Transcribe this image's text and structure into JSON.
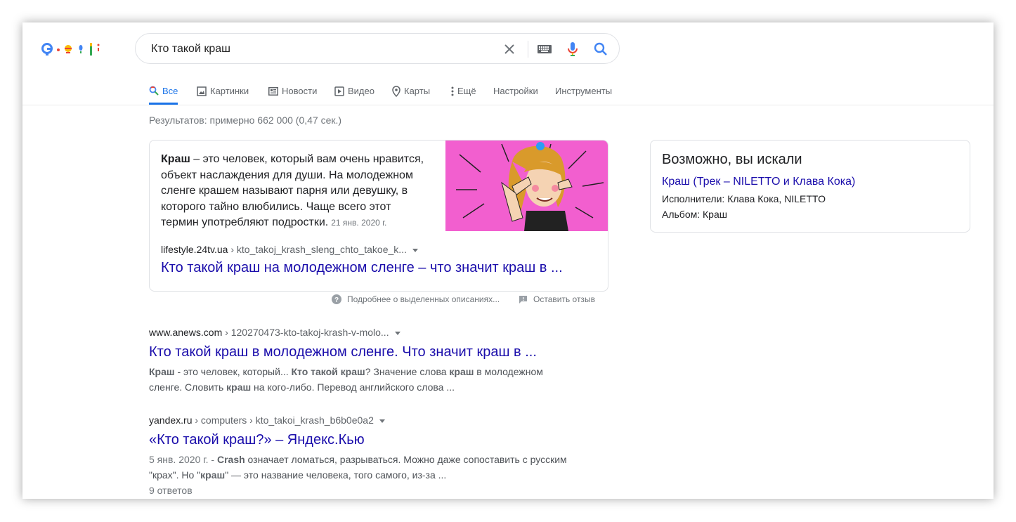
{
  "search": {
    "query": "Кто такой краш",
    "clear_icon": "close-icon",
    "keyboard_icon": "keyboard-icon",
    "mic_icon": "microphone-icon",
    "search_icon": "search-icon"
  },
  "tabs": [
    {
      "label": "Все",
      "icon": "search-icon",
      "active": true
    },
    {
      "label": "Картинки",
      "icon": "image-icon"
    },
    {
      "label": "Новости",
      "icon": "news-icon"
    },
    {
      "label": "Видео",
      "icon": "video-icon"
    },
    {
      "label": "Карты",
      "icon": "map-pin-icon"
    },
    {
      "label": "Ещё",
      "icon": "more-vert-icon"
    },
    {
      "label": "Настройки"
    },
    {
      "label": "Инструменты"
    }
  ],
  "stats": "Результатов: примерно 662 000 (0,47 сек.)",
  "featured": {
    "bold": "Краш",
    "text": " – это человек, который вам очень нравится, объект наслаждения для души. На молодежном сленге крашем называют парня или девушку, в которого тайно влюбились. Чаще всего этот термин употребляют подростки.",
    "date": "21 янв. 2020 г.",
    "domain": "lifestyle.24tv.ua",
    "path": " › kto_takoj_krash_sleng_chto_takoe_k...",
    "title": "Кто такой краш на молодежном сленге – что значит краш в ...",
    "image_alt": "cartoon girl with hands on face"
  },
  "feedback": {
    "about": "Подробнее о выделенных описаниях...",
    "send": "Оставить отзыв"
  },
  "results": [
    {
      "domain": "www.anews.com",
      "path": " › 120270473-kto-takoj-krash-v-molo...",
      "title": "Кто такой краш в молодежном сленге. Что значит краш в ...",
      "desc": [
        {
          "b": "Краш"
        },
        {
          "t": " - это человек, который... "
        },
        {
          "b": "Кто такой краш"
        },
        {
          "t": "? Значение слова "
        },
        {
          "b": "краш"
        },
        {
          "t": " в молодежном сленге. Словить "
        },
        {
          "b": "краш"
        },
        {
          "t": " на кого-либо. Перевод английского слова ..."
        }
      ]
    },
    {
      "domain": "yandex.ru",
      "path": " › computers › kto_takoi_krash_b6b0e0a2",
      "title": "«Кто такой краш?» – Яндекс.Кью",
      "desc": [
        {
          "t": "5 янв. 2020 г. - "
        },
        {
          "b": "Crash"
        },
        {
          "t": " означает ломаться, разрываться. Можно даже сопоставить с русским \"крах\". Но \""
        },
        {
          "b": "краш"
        },
        {
          "t": "\" — это название человека, того самого, из-за ..."
        }
      ],
      "meta": "9 ответов"
    }
  ],
  "panel": {
    "heading": "Возможно, вы искали",
    "link": "Краш (Трек – NILETTO и Клава Кока)",
    "artists_label": "Исполнители:",
    "artists": " Клава Кока, NILETTO",
    "album_label": "Альбом:",
    "album": " Краш"
  },
  "colors": {
    "link": "#1a0dab",
    "accent": "#1a73e8",
    "image_bg": "#f25fcf"
  }
}
